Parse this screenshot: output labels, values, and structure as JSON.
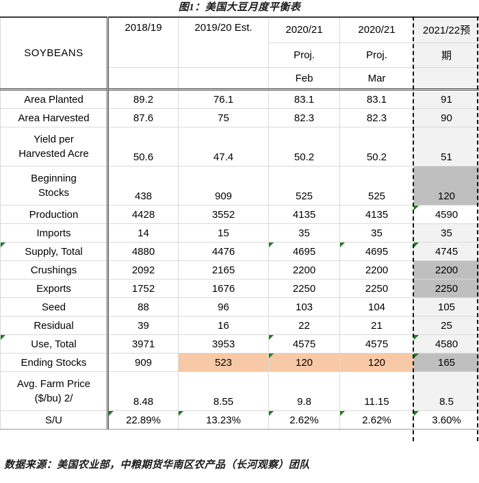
{
  "title": "图1：美国大豆月度平衡表",
  "source_note": "数据来源：美国农业部，中粮期货华南区农产品（长河观察）团队",
  "colors": {
    "highlight_peach": "#f8c9a6",
    "highlight_gray": "#bfbfbf",
    "column_tint": "#f2f2f2",
    "comment_marker_green": "#1e7a24",
    "selection_dash": "#111111"
  },
  "table": {
    "corner_label": "SOYBEANS",
    "headers": [
      {
        "line1": "2018/19",
        "line2": "",
        "line3": ""
      },
      {
        "line1": "2019/20 Est.",
        "line2": "",
        "line3": ""
      },
      {
        "line1": "2020/21",
        "line2": "Proj.",
        "line3": "Feb"
      },
      {
        "line1": "2020/21",
        "line2": "Proj.",
        "line3": "Mar"
      },
      {
        "line1": "2021/22预",
        "line2": "期",
        "line3": ""
      }
    ],
    "rows": [
      {
        "label": "Area Planted",
        "values": [
          "89.2",
          "76.1",
          "83.1",
          "83.1",
          "91"
        ]
      },
      {
        "label": "Area Harvested",
        "values": [
          "87.6",
          "75",
          "82.3",
          "82.3",
          "90"
        ]
      },
      {
        "label": "Yield per\nHarvested Acre",
        "values": [
          "50.6",
          "47.4",
          "50.2",
          "50.2",
          "51"
        ]
      },
      {
        "label": "Beginning\nStocks",
        "values": [
          "438",
          "909",
          "525",
          "525",
          "120"
        ]
      },
      {
        "label": "Production",
        "values": [
          "4428",
          "3552",
          "4135",
          "4135",
          "4590"
        ]
      },
      {
        "label": "Imports",
        "values": [
          "14",
          "15",
          "35",
          "35",
          "35"
        ]
      },
      {
        "label": "Supply, Total",
        "values": [
          "4880",
          "4476",
          "4695",
          "4695",
          "4745"
        ]
      },
      {
        "label": "Crushings",
        "values": [
          "2092",
          "2165",
          "2200",
          "2200",
          "2200"
        ]
      },
      {
        "label": "Exports",
        "values": [
          "1752",
          "1676",
          "2250",
          "2250",
          "2250"
        ]
      },
      {
        "label": "Seed",
        "values": [
          "88",
          "96",
          "103",
          "104",
          "105"
        ]
      },
      {
        "label": "Residual",
        "values": [
          "39",
          "16",
          "22",
          "21",
          "25"
        ]
      },
      {
        "label": "Use, Total",
        "values": [
          "3971",
          "3953",
          "4575",
          "4575",
          "4580"
        ]
      },
      {
        "label": "Ending Stocks",
        "values": [
          "909",
          "523",
          "120",
          "120",
          "165"
        ]
      },
      {
        "label": "Avg. Farm Price\n($/bu)  2/",
        "values": [
          "8.48",
          "8.55",
          "9.8",
          "11.15",
          "8.5"
        ]
      },
      {
        "label": "S/U",
        "values": [
          "22.89%",
          "13.23%",
          "2.62%",
          "2.62%",
          "3.60%"
        ]
      }
    ]
  }
}
